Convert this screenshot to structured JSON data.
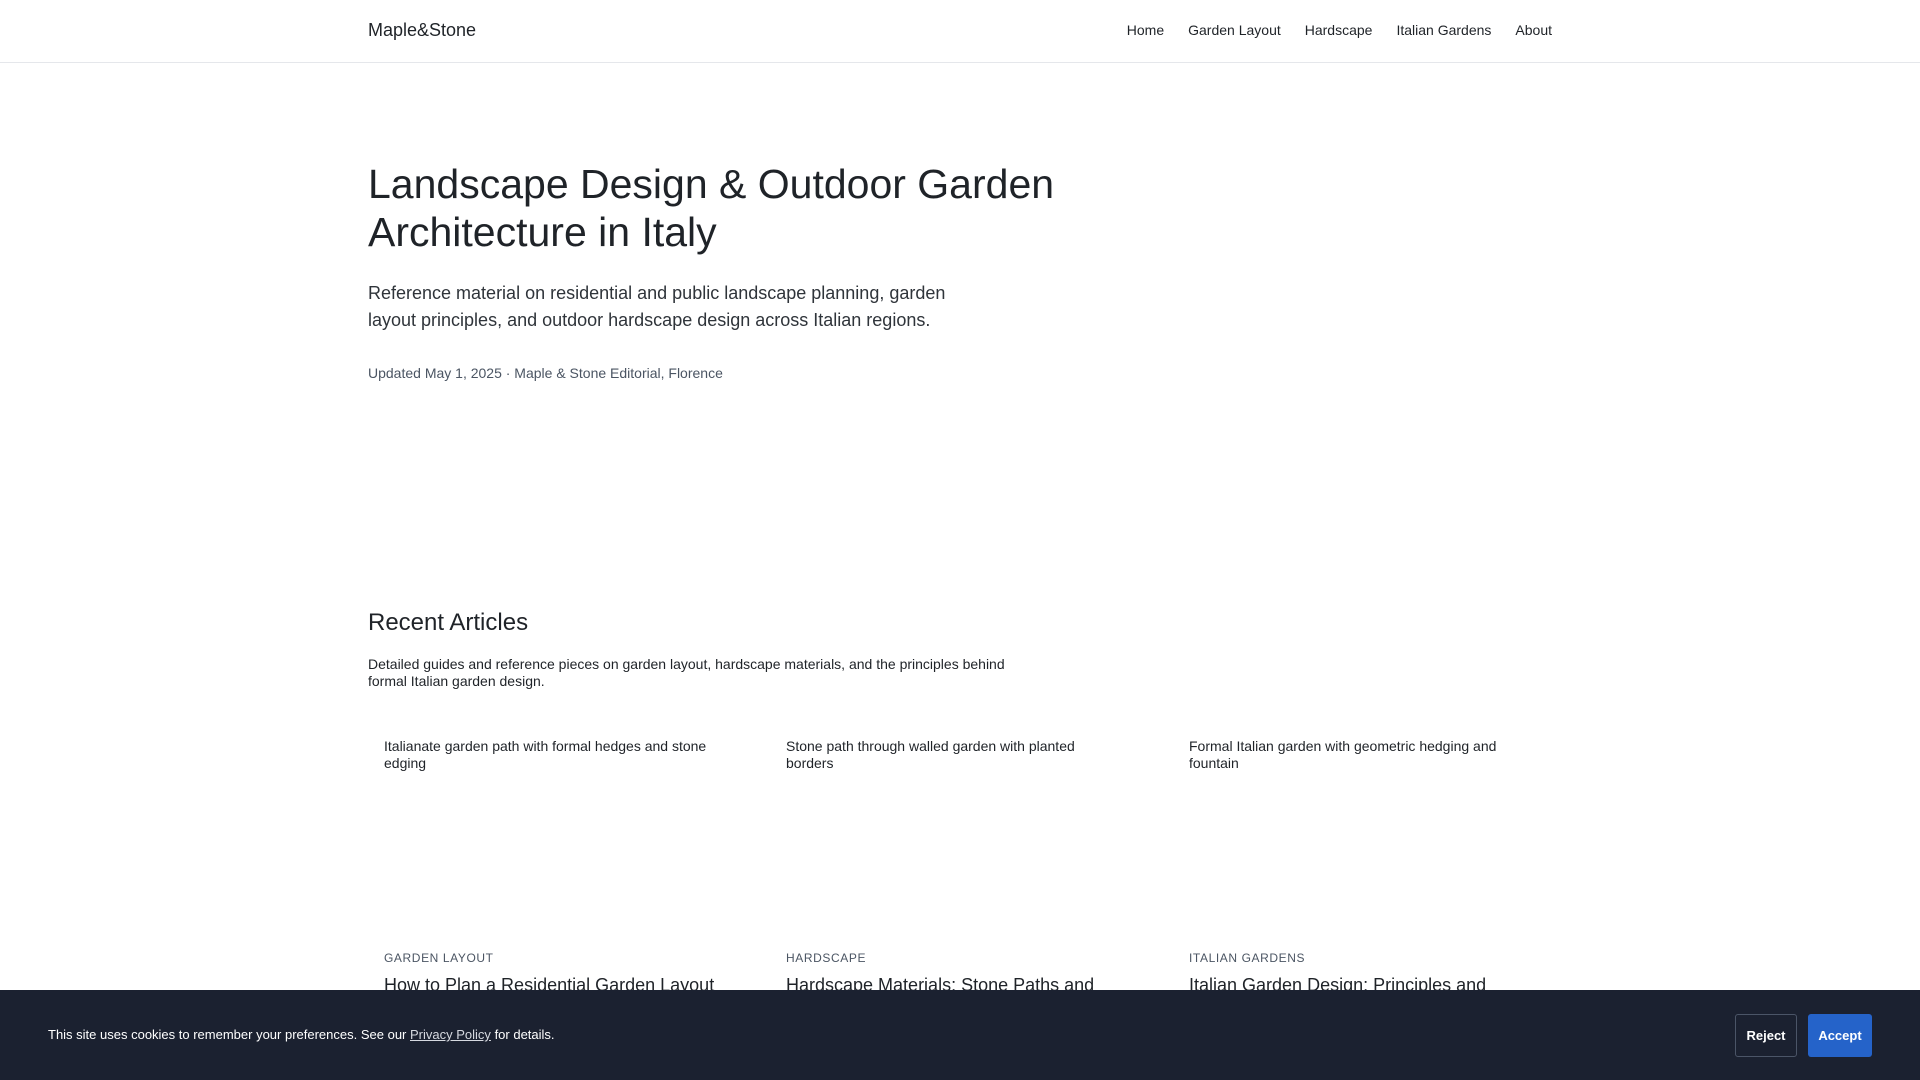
{
  "header": {
    "brand": "Maple&Stone",
    "nav": [
      "Home",
      "Garden Layout",
      "Hardscape",
      "Italian Gardens",
      "About"
    ]
  },
  "hero": {
    "title": "Landscape Design & Outdoor Garden Architecture in Italy",
    "lead": "Reference material on residential and public landscape planning, garden layout principles, and outdoor hardscape design across Italian regions.",
    "meta": "Updated May 1, 2025 · Maple & Stone Editorial, Florence"
  },
  "recent": {
    "title": "Recent Articles",
    "description": "Detailed guides and reference pieces on garden layout, hardscape materials, and the principles behind formal Italian garden design.",
    "articles": [
      {
        "image_alt": "Italianate garden path with formal hedges and stone edging",
        "category": "GARDEN LAYOUT",
        "title": "How to Plan a Residential Garden Layout"
      },
      {
        "image_alt": "Stone path through walled garden with planted borders",
        "category": "HARDSCAPE",
        "title": "Hardscape Materials: Stone Paths and"
      },
      {
        "image_alt": "Formal Italian garden with geometric hedging and fountain",
        "category": "ITALIAN GARDENS",
        "title": "Italian Garden Design: Principles and"
      }
    ]
  },
  "cookie": {
    "text_before": "This site uses cookies to remember your preferences. See our",
    "link": "Privacy Policy",
    "text_after": "for details.",
    "reject": "Reject",
    "accept": "Accept"
  }
}
